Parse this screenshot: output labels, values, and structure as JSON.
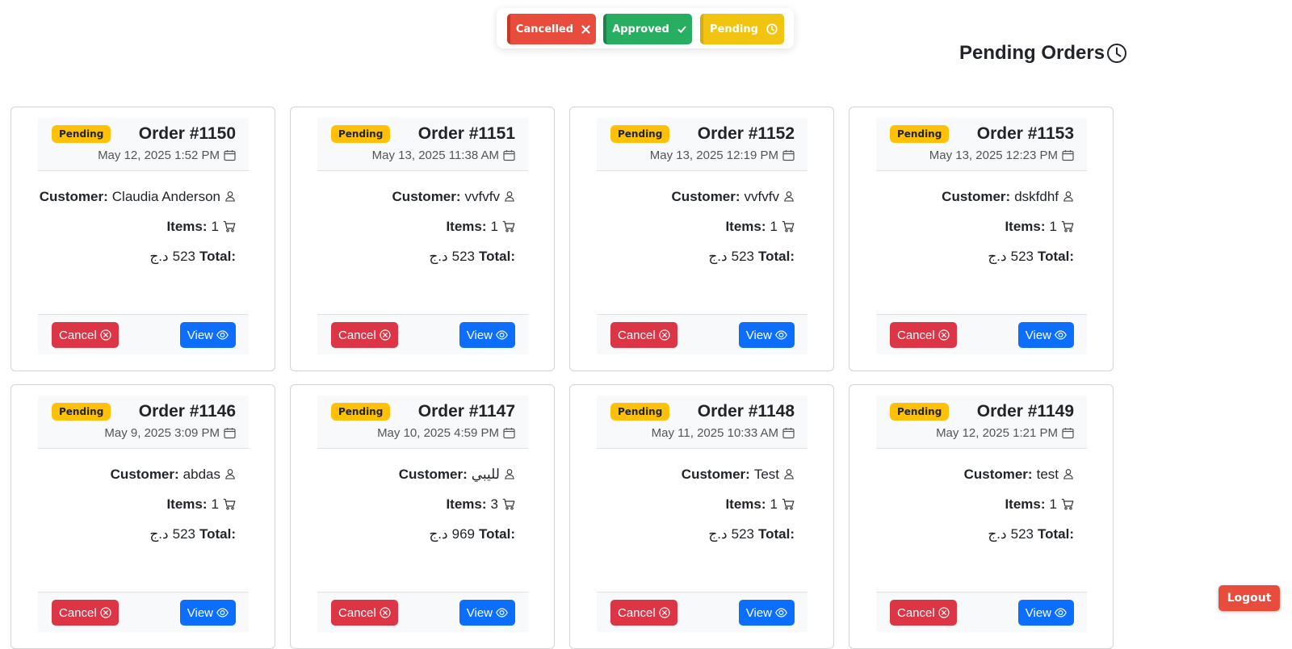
{
  "filters": {
    "cancelled_label": "Cancelled",
    "approved_label": "Approved",
    "pending_label": "Pending"
  },
  "page_title": "Pending Orders",
  "labels": {
    "customer": "Customer:",
    "items": "Items:",
    "total": "Total:",
    "cancel": "Cancel",
    "view": "View",
    "currency": "د.ج"
  },
  "orders": [
    {
      "status": "Pending",
      "number": "Order #1150",
      "date": "May 12, 2025 1:52 PM",
      "customer": "Claudia Anderson",
      "items": "1",
      "total": "523"
    },
    {
      "status": "Pending",
      "number": "Order #1151",
      "date": "May 13, 2025 11:38 AM",
      "customer": "vvfvfv",
      "items": "1",
      "total": "523"
    },
    {
      "status": "Pending",
      "number": "Order #1152",
      "date": "May 13, 2025 12:19 PM",
      "customer": "vvfvfv",
      "items": "1",
      "total": "523"
    },
    {
      "status": "Pending",
      "number": "Order #1153",
      "date": "May 13, 2025 12:23 PM",
      "customer": "dskfdhf",
      "items": "1",
      "total": "523"
    },
    {
      "status": "Pending",
      "number": "Order #1146",
      "date": "May 9, 2025 3:09 PM",
      "customer": "abdas",
      "items": "1",
      "total": "523"
    },
    {
      "status": "Pending",
      "number": "Order #1147",
      "date": "May 10, 2025 4:59 PM",
      "customer": "لليبي",
      "items": "3",
      "total": "969"
    },
    {
      "status": "Pending",
      "number": "Order #1148",
      "date": "May 11, 2025 10:33 AM",
      "customer": "Test",
      "items": "1",
      "total": "523"
    },
    {
      "status": "Pending",
      "number": "Order #1149",
      "date": "May 12, 2025 1:21 PM",
      "customer": "test",
      "items": "1",
      "total": "523"
    }
  ],
  "logout_label": "Logout",
  "colors": {
    "cancelled": "#e74c3c",
    "approved": "#27ae60",
    "pending": "#f1c40f",
    "badge": "#ffc107",
    "cancel_button": "#dc3545",
    "view_button": "#0d6efd"
  }
}
